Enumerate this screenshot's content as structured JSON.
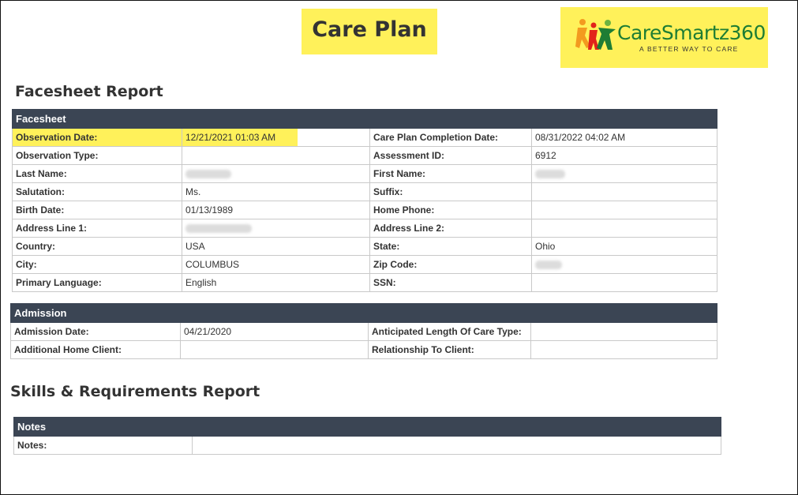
{
  "header": {
    "title": "Care Plan",
    "logo": {
      "name": "CareSmartz360",
      "tagline": "A BETTER WAY TO CARE",
      "icon": "people-figures-icon"
    }
  },
  "colors": {
    "highlight": "#fff15a",
    "section_header_bg": "#3b4554",
    "logo_green": "#1e7d34",
    "logo_orange": "#f39a1f",
    "logo_red": "#e2231a"
  },
  "facesheet_report": {
    "title": "Facesheet Report",
    "section": "Facesheet",
    "rows": [
      {
        "label_left": "Observation Date:",
        "value_left": "12/21/2021 01:03 AM",
        "label_right": "Care Plan Completion Date:",
        "value_right": "08/31/2022 04:02 AM"
      },
      {
        "label_left": "Observation Type:",
        "value_left": "",
        "label_right": "Assessment ID:",
        "value_right": "6912"
      },
      {
        "label_left": "Last Name:",
        "value_left": "",
        "label_right": "First Name:",
        "value_right": ""
      },
      {
        "label_left": "Salutation:",
        "value_left": "Ms.",
        "label_right": "Suffix:",
        "value_right": ""
      },
      {
        "label_left": "Birth Date:",
        "value_left": "01/13/1989",
        "label_right": "Home Phone:",
        "value_right": ""
      },
      {
        "label_left": "Address Line 1:",
        "value_left": "",
        "label_right": "Address Line 2:",
        "value_right": ""
      },
      {
        "label_left": "Country:",
        "value_left": "USA",
        "label_right": "State:",
        "value_right": "Ohio"
      },
      {
        "label_left": "City:",
        "value_left": "COLUMBUS",
        "label_right": "Zip Code:",
        "value_right": ""
      },
      {
        "label_left": "Primary Language:",
        "value_left": "English",
        "label_right": "SSN:",
        "value_right": ""
      }
    ],
    "admission": {
      "section": "Admission",
      "rows": [
        {
          "label_left": "Admission Date:",
          "value_left": "04/21/2020",
          "label_right": "Anticipated Length Of Care Type:",
          "value_right": ""
        },
        {
          "label_left": "Additional Home Client:",
          "value_left": "",
          "label_right": "Relationship To Client:",
          "value_right": ""
        }
      ]
    }
  },
  "skills_report": {
    "title": "Skills & Requirements Report",
    "section": "Notes",
    "rows": [
      {
        "label": "Notes:",
        "value": ""
      }
    ]
  }
}
